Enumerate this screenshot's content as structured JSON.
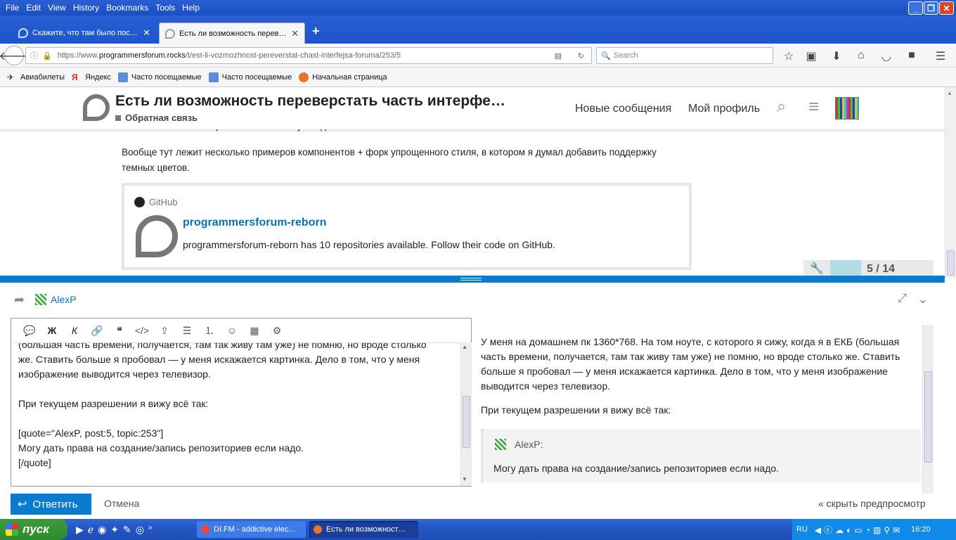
{
  "menu": [
    "File",
    "Edit",
    "View",
    "History",
    "Bookmarks",
    "Tools",
    "Help"
  ],
  "tabs": [
    {
      "label": "Скажите, что там было пос…",
      "active": false
    },
    {
      "label": "Есть ли возможность перев…",
      "active": true
    }
  ],
  "nav": {
    "url_prefix": "https://www.",
    "url_domain": "programmersforum.rocks",
    "url_path": "/t/est-li-vozmozhnost-pereverstat-chast-interfejsa-foruma/253/5",
    "search_placeholder": "Search"
  },
  "bookmarks": [
    "Авиабилеты",
    "Яндекс",
    "Часто посещаемые",
    "Часто посещаемые",
    "Начальная страница"
  ],
  "header": {
    "title": "Есть ли возможность переверстать часть интерфе…",
    "category": "Обратная связь",
    "links": [
      "Новые сообщения",
      "Мой профиль"
    ]
  },
  "post": {
    "cut_line": "Так что изменение ширины окна ответа нужно добавить в этот же компонент.",
    "paragraph": "Вообще тут лежит несколько примеров компонентов + форк упрощенного стиля, в котором я думал добавить поддержку темных цветов.",
    "onebox": {
      "source": "GitHub",
      "title": "programmersforum-reborn",
      "description": "programmersforum-reborn has 10 repositories available. Follow their code on GitHub."
    }
  },
  "progress": {
    "current": "5",
    "total": "14",
    "label": "5 / 14"
  },
  "composer": {
    "reply_to": "AlexP",
    "editor_lines": [
      "(большая часть времени, получается, там так живу там уже) не помню, но вроде столько",
      "же. Ставить больше я пробовал — у меня искажается картинка. Дело в том, что у меня",
      "изображение выводится через телевизор.",
      "",
      "При текущем разрешении я вижу всё так:",
      "",
      "[quote=\"AlexP, post:5, topic:253\"]",
      "Могу дать права на создание/запись репозиториев если надо.",
      "[/quote]"
    ],
    "preview_p1": "У меня на домашнем пк 1360*768. На том ноуте, с которого я сижу, когда я в ЕКБ (большая часть времени, получается, там так живу там уже) не помню, но вроде столько же. Ставить больше я пробовал — у меня искажается картинка. Дело в том, что у меня изображение выводится через телевизор.",
    "preview_p2": "При текущем разрешении я вижу всё так:",
    "quote_author": "AlexP:",
    "quote_text": "Могу дать права на создание/запись репозиториев если надо.",
    "reply_button": "Ответить",
    "cancel": "Отмена",
    "hide_preview": "« скрыть предпросмотр"
  },
  "taskbar": {
    "start": "пуск",
    "tasks": [
      "DI.FM - addictive elec…",
      "Есть ли возможност…"
    ],
    "lang": "RU",
    "time": "16:20"
  },
  "colors": {
    "accent": "#0b7bd0",
    "link": "#0a70b8",
    "xp_blue": "#245edb",
    "start_green": "#3c9a3c"
  }
}
